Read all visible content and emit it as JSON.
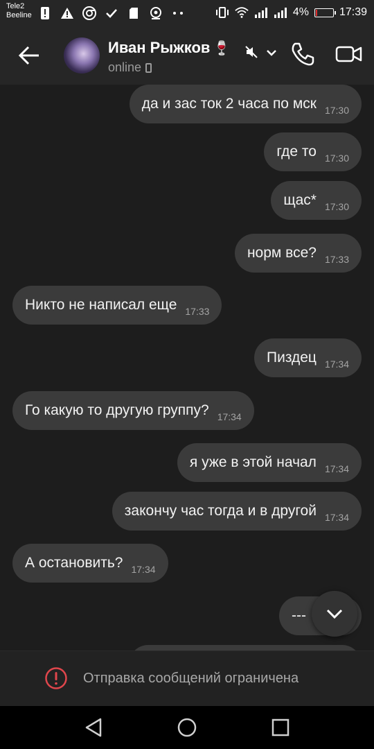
{
  "statusbar": {
    "carrier1": "Tele2",
    "carrier2": "Beeline",
    "battery_percent": "4%",
    "battery_level": 0.04,
    "time": "17:39"
  },
  "header": {
    "contact_name": "Иван Рыжков",
    "status": "online"
  },
  "messages": [
    {
      "dir": "out",
      "text": "да и зас ток 2 часа по мск",
      "time": "17:30"
    },
    {
      "dir": "out",
      "text": "где то",
      "time": "17:30"
    },
    {
      "dir": "out",
      "text": "щас*",
      "time": "17:30"
    },
    {
      "dir": "out",
      "text": "норм все?",
      "time": "17:33"
    },
    {
      "dir": "in",
      "text": "Никто не написал еще",
      "time": "17:33"
    },
    {
      "dir": "out",
      "text": "Пиздец",
      "time": "17:34"
    },
    {
      "dir": "in",
      "text": "Го какую то другую группу?",
      "time": "17:34"
    },
    {
      "dir": "out",
      "text": "я уже в этой начал",
      "time": "17:34"
    },
    {
      "dir": "out",
      "text": "закончу час тогда и в другой",
      "time": "17:34"
    },
    {
      "dir": "in",
      "text": "А остановить?",
      "time": "17:34"
    },
    {
      "dir": "out",
      "text": "---",
      "time": ""
    }
  ],
  "footer": {
    "restricted_text": "Отправка сообщений ограничена"
  },
  "colors": {
    "background": "#1d1d1d",
    "bubble": "#3b3b3b",
    "warning": "#e0464c"
  }
}
